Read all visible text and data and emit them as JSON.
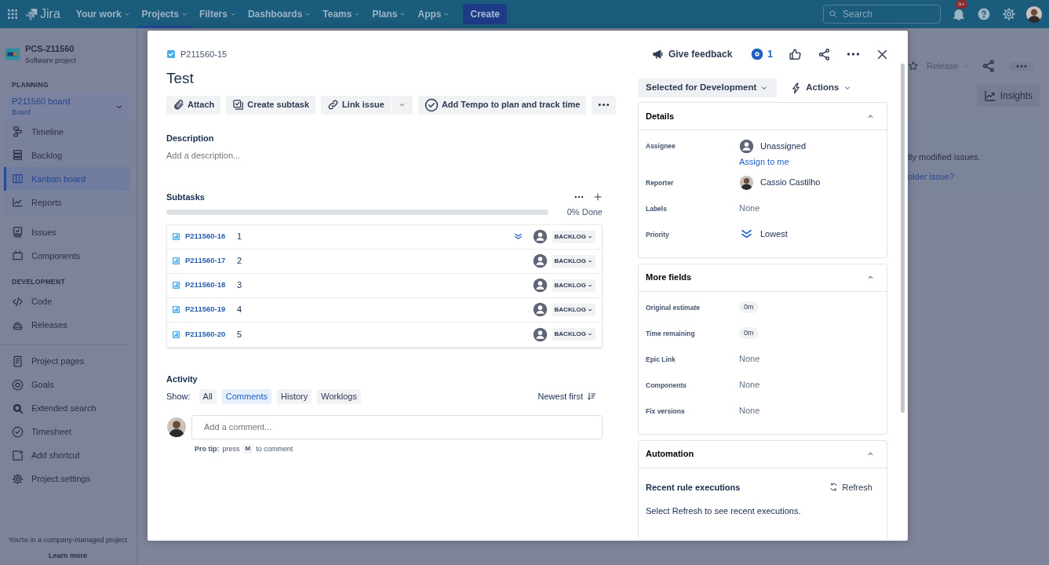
{
  "topnav": {
    "logo": "Jira",
    "items": [
      {
        "label": "Your work",
        "selected": false
      },
      {
        "label": "Projects",
        "selected": true
      },
      {
        "label": "Filters",
        "selected": false
      },
      {
        "label": "Dashboards",
        "selected": false
      },
      {
        "label": "Teams",
        "selected": false
      },
      {
        "label": "Plans",
        "selected": false
      },
      {
        "label": "Apps",
        "selected": false
      }
    ],
    "create": "Create",
    "search": {
      "placeholder": "Search"
    },
    "notifications_badge": "9+"
  },
  "sidebar": {
    "project": {
      "name": "PCS-211560",
      "type": "Software project"
    },
    "planning": {
      "heading": "PLANNING",
      "board": {
        "name": "P211560 board",
        "sub": "Board",
        "expanded": true
      },
      "items": [
        {
          "label": "Timeline",
          "selected": false
        },
        {
          "label": "Backlog",
          "selected": false
        },
        {
          "label": "Kanban board",
          "selected": true
        },
        {
          "label": "Reports",
          "selected": false
        }
      ]
    },
    "items": [
      {
        "label": "Issues",
        "selected": false
      },
      {
        "label": "Components",
        "selected": false
      }
    ],
    "development": {
      "heading": "DEVELOPMENT",
      "items": [
        {
          "label": "Code",
          "selected": false
        },
        {
          "label": "Releases",
          "selected": false
        }
      ]
    },
    "extra_items": [
      {
        "label": "Project pages",
        "selected": false
      },
      {
        "label": "Goals",
        "selected": false
      },
      {
        "label": "Extended search",
        "selected": false
      },
      {
        "label": "Timesheet",
        "selected": false
      },
      {
        "label": "Add shortcut",
        "selected": false
      },
      {
        "label": "Project settings",
        "selected": false
      }
    ],
    "footer": {
      "text": "You're in a company-managed project",
      "link": "Learn more"
    }
  },
  "background": {
    "release": "Release",
    "insights": "Insights",
    "text": "tly modified issues.",
    "link": "older issue?"
  },
  "issue": {
    "key": "P211560-15",
    "feedback": "Give feedback",
    "watchers": "1",
    "title": "Test",
    "toolbar": [
      "Attach",
      "Create subtask",
      "Link issue",
      "Add Tempo to plan and track time"
    ],
    "description": {
      "label": "Description",
      "placeholder": "Add a description..."
    },
    "subtasks": {
      "label": "Subtasks",
      "level": 0,
      "done": "0% Done",
      "rows": [
        {
          "key": "P211560-16",
          "summary": "1",
          "show_priority": true,
          "status": "BACKLOG"
        },
        {
          "key": "P211560-17",
          "summary": "2",
          "show_priority": false,
          "status": "BACKLOG"
        },
        {
          "key": "P211560-18",
          "summary": "3",
          "show_priority": false,
          "status": "BACKLOG"
        },
        {
          "key": "P211560-19",
          "summary": "4",
          "show_priority": false,
          "status": "BACKLOG"
        },
        {
          "key": "P211560-20",
          "summary": "5",
          "show_priority": false,
          "status": "BACKLOG"
        }
      ]
    },
    "activity": {
      "label": "Activity",
      "show": "Show:",
      "filters": [
        {
          "label": "All",
          "selected": false
        },
        {
          "label": "Comments",
          "selected": true
        },
        {
          "label": "History",
          "selected": false
        },
        {
          "label": "Worklogs",
          "selected": false
        }
      ],
      "sort": "Newest first",
      "comment_placeholder": "Add a comment...",
      "tip": {
        "label": "Pro tip:",
        "before": "press",
        "key": "M",
        "after": "to comment"
      }
    },
    "status": "Selected for Development",
    "actions": "Actions",
    "panels": [
      {
        "title": "Details",
        "expanded": true,
        "fields": [
          {
            "label": "Assignee",
            "kind": "user",
            "value": "Unassigned",
            "link": "Assign to me"
          },
          {
            "label": "Reporter",
            "kind": "person",
            "value": "Cassio Castilho"
          },
          {
            "label": "Labels",
            "kind": "empty",
            "value": "None"
          },
          {
            "label": "Priority",
            "kind": "priority",
            "value": "Lowest"
          }
        ]
      },
      {
        "title": "More fields",
        "expanded": true,
        "fields": [
          {
            "label": "Original estimate",
            "kind": "time",
            "value": "0m"
          },
          {
            "label": "Time remaining",
            "kind": "time",
            "value": "0m"
          },
          {
            "label": "Epic Link",
            "kind": "empty",
            "value": "None"
          },
          {
            "label": "Components",
            "kind": "empty",
            "value": "None"
          },
          {
            "label": "Fix versions",
            "kind": "empty",
            "value": "None"
          }
        ]
      },
      {
        "title": "Automation",
        "expanded": true,
        "kind": "automation",
        "heading": "Recent rule executions",
        "refresh": "Refresh",
        "text": "Select Refresh to see recent executions."
      }
    ]
  }
}
